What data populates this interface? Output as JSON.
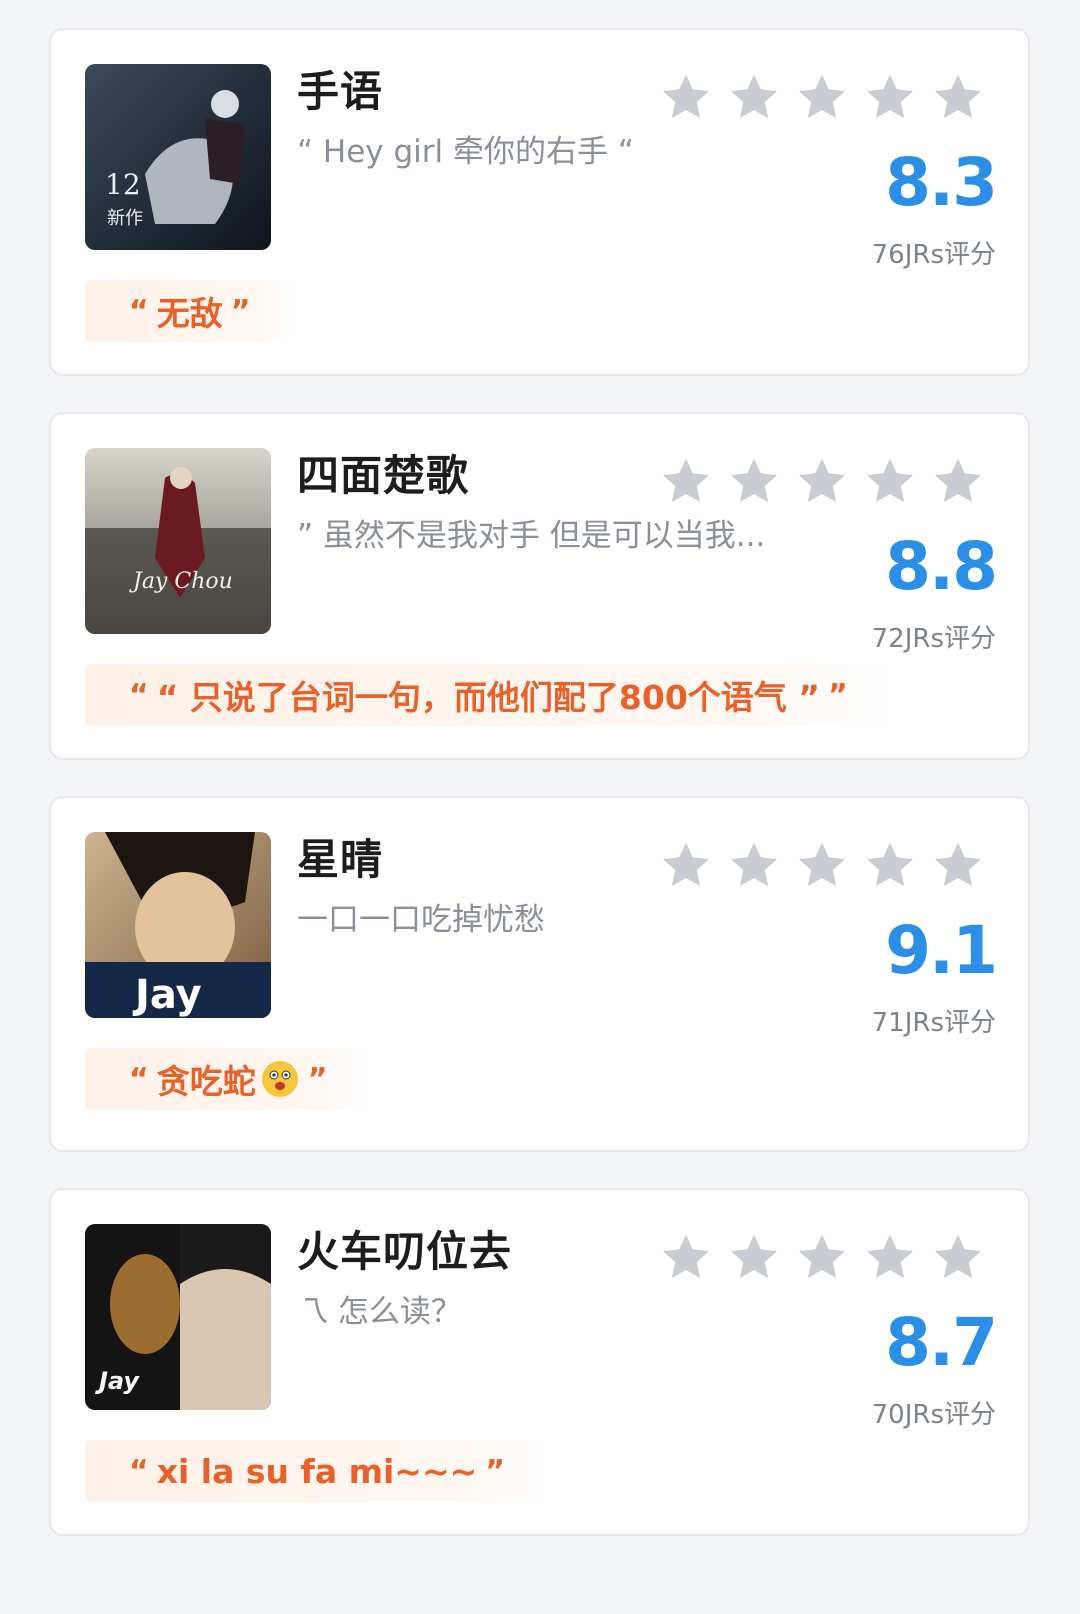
{
  "songs": [
    {
      "title": "手语",
      "subtitle": "“ Hey girl 牵你的右手 “",
      "score": "8.3",
      "count": "76JRs评分",
      "tag_open": "“",
      "tag": "无敌",
      "tag_close": "”",
      "stars": 5
    },
    {
      "title": "四面楚歌",
      "subtitle": "” 虽然不是我对手 但是可以当我...",
      "score": "8.8",
      "count": "72JRs评分",
      "tag_open": "“",
      "tag": "“ 只说了台词一句，而他们配了800个语气 ”",
      "tag_close": "”",
      "stars": 5
    },
    {
      "title": "星晴",
      "subtitle": "一口一口吃掉忧愁",
      "score": "9.1",
      "count": "71JRs评分",
      "tag_open": "“",
      "tag": "贪吃蛇",
      "tag_close": "”",
      "stars": 5
    },
    {
      "title": "火车叨位去",
      "subtitle": "乁 怎么读？",
      "score": "8.7",
      "count": "70JRs评分",
      "tag_open": "“",
      "tag": "xi la su fa mi~~~",
      "tag_close": "”",
      "stars": 5
    }
  ],
  "colors": {
    "score": "#2b8fe8",
    "tag_text": "#e8612a",
    "tag_bg": "#fdf1e7",
    "star": "#c9ccd3"
  },
  "icons": {
    "star": "star-icon",
    "emoji": "dizzy-face-emoji-icon"
  }
}
